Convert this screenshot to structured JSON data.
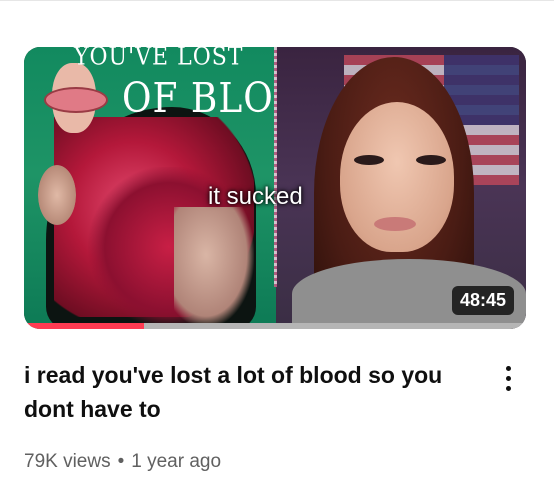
{
  "video": {
    "thumbnail": {
      "book_title_line1": "YOU'VE LOST",
      "book_title_line2": "OF BLOOD",
      "caption": "it sucked",
      "duration": "48:45",
      "watched_fraction": 0.24
    },
    "title": "i read you've lost a lot of blood so you dont have to",
    "views": "79K views",
    "separator": "•",
    "age": "1 year ago",
    "more_icon": "vertical-ellipsis-icon"
  },
  "colors": {
    "progress": "#ff3b52",
    "title_text": "#0f0f0f",
    "meta_text": "#606060"
  }
}
